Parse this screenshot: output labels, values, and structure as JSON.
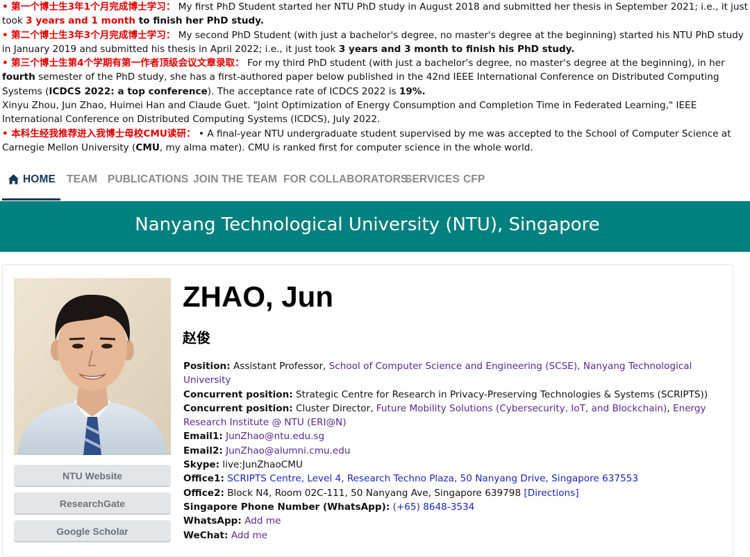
{
  "news": {
    "item1": {
      "bullet": "•",
      "cn": "第一个博士生3年1个月完成博士学习：",
      "text_a": " My first PhD Student started her NTU PhD study in August 2018 and submitted her thesis in September 2021; i.e., it just took ",
      "red_b": "3 years and 1 month",
      "bold_c": " to finish her PhD study."
    },
    "item2": {
      "bullet": "•",
      "cn": "第二个博士生3年3个月完成博士学习：",
      "text_a": " My second PhD Student (with just a bachelor's degree, no master's degree at the beginning) started his NTU PhD study in January 2019 and submitted his thesis in April 2022; i.e., it just took ",
      "bold_b": "3 years and 3 month to finish his PhD study."
    },
    "item3": {
      "bullet": "•",
      "cn": "第三个博士生第4个学期有第一作者顶级会议文章录取：",
      "text_a": " For my third PhD student (with just a bachelor's degree, no master's degree at the beginning), in her ",
      "bold_b": "fourth",
      "text_c": " semester of the PhD study, she has a first-authored paper below published in the 42nd IEEE International Conference on Distributed Computing Systems (",
      "bold_d": "ICDCS 2022: a top conference",
      "text_e": "). The acceptance rate of ICDCS 2022 is ",
      "bold_f": "19%.",
      "citation": "Xinyu Zhou, Jun Zhao, Huimei Han and Claude Guet. \"Joint Optimization of Energy Consumption and Completion Time in Federated Learning,\" IEEE International Conference on Distributed Computing Systems (ICDCS), July 2022."
    },
    "item4": {
      "bullet": "•",
      "cn": "本科生经我推荐进入我博士母校CMU读研：",
      "text_a": " • A final-year NTU undergraduate student supervised by me was accepted to the School of Computer Science at Carnegie Mellon University (",
      "bold_b": "CMU",
      "text_c": ", my alma mater). CMU is ranked first for computer science in the whole world."
    }
  },
  "nav": {
    "home": "HOME",
    "team": "TEAM",
    "publications": "PUBLICATIONS",
    "join": "JOIN THE TEAM",
    "collaborators": "FOR COLLABORATORS",
    "services": "SERVICES",
    "cfp": "CFP"
  },
  "banner": {
    "title": "Nanyang Technological University (NTU), Singapore"
  },
  "sidebar": {
    "ntu": "NTU Website",
    "researchgate": "ResearchGate",
    "scholar": "Google Scholar"
  },
  "profile": {
    "name": "ZHAO, Jun",
    "cname": "赵俊",
    "position_label": "Position:",
    "position_text": " Assistant Professor, ",
    "position_link": "School of Computer Science and Engineering (SCSE), Nanyang Technological University",
    "concurrent1_label": "Concurrent position:",
    "concurrent1_text": " Strategic Centre for Research in Privacy-Preserving Technologies & Systems (SCRIPTS))",
    "concurrent2_label": "Concurrent position:",
    "concurrent2_text": " Cluster Director, ",
    "concurrent2_link1": "Future Mobility Solutions (Cybersecurity, IoT, and Blockchain)",
    "concurrent2_sep": ", ",
    "concurrent2_link2": "Energy Research Institute @ NTU (ERI@N)",
    "email1_label": "Email1:",
    "email1": "JunZhao@ntu.edu.sg",
    "email2_label": "Email2:",
    "email2": "JunZhao@alumni.cmu.edu",
    "skype_label": "Skype:",
    "skype": " live:JunZhaoCMU",
    "office1_label": "Office1:",
    "office1": "SCRIPTS Centre, Level 4, Research Techno Plaza, 50 Nanyang Drive, Singapore 637553",
    "office2_label": "Office2:",
    "office2": " Block N4, Room 02C-111, 50 Nanyang Ave, Singapore 639798 ",
    "office2_link": "[Directions]",
    "phone_label": "Singapore Phone Number (WhatsApp):",
    "phone": "(+65) 8648-3534",
    "whatsapp_label": "WhatsApp:",
    "whatsapp": "Add me",
    "wechat_label": "WeChat:",
    "wechat": "Add me"
  }
}
